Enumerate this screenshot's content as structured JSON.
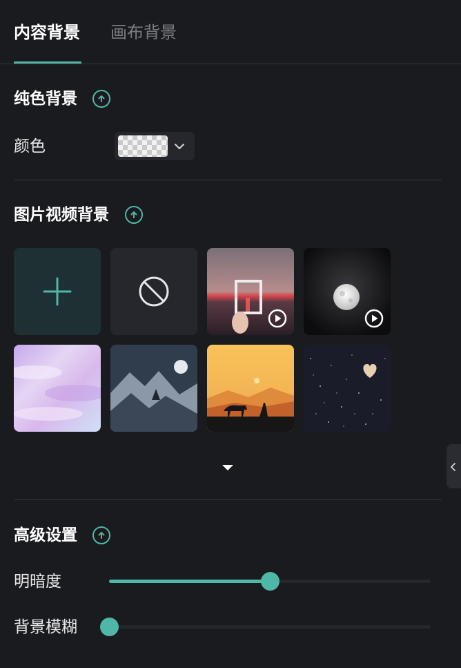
{
  "tabs": [
    {
      "label": "内容背景",
      "active": true
    },
    {
      "label": "画布背景",
      "active": false
    }
  ],
  "solid_section": {
    "title": "纯色背景",
    "color_label": "颜色",
    "color_value": "transparent"
  },
  "media_section": {
    "title": "图片视频背景",
    "items": [
      {
        "kind": "add",
        "icon": "plus-icon"
      },
      {
        "kind": "none",
        "icon": "prohibited-icon"
      },
      {
        "kind": "video",
        "icon": "play-icon"
      },
      {
        "kind": "video",
        "icon": "play-icon"
      },
      {
        "kind": "image"
      },
      {
        "kind": "image"
      },
      {
        "kind": "image"
      },
      {
        "kind": "image"
      }
    ],
    "expand_icon": "caret-down-icon"
  },
  "advanced_section": {
    "title": "高级设置",
    "brightness_label": "明暗度",
    "brightness_value": 0.5,
    "blur_label": "背景模糊",
    "blur_value": 0
  },
  "colors": {
    "accent": "#4fb7a8",
    "background": "#1a1b1f",
    "tile": "#26272c",
    "add_tile": "#1f3035"
  }
}
